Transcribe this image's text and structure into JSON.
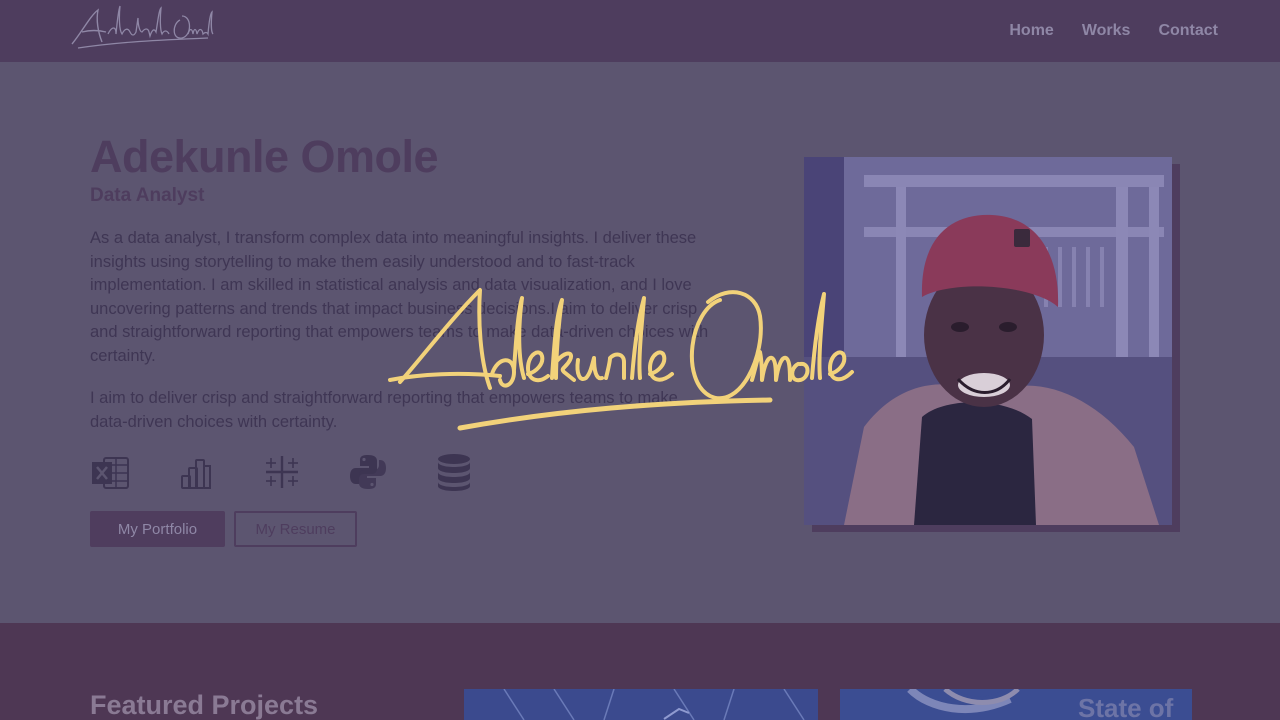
{
  "nav": {
    "logo_text": "Adekunle Omole",
    "links": [
      "Home",
      "Works",
      "Contact"
    ]
  },
  "hero": {
    "name": "Adekunle Omole",
    "role": "Data Analyst",
    "bio_paragraph_1": "As a data analyst, I transform complex data into meaningful insights. I deliver these insights using storytelling to make them easily understood and to fast-track implementation. I am skilled in statistical analysis and data visualization, and I love uncovering patterns and trends that impact business decisions.I aim to deliver crisp and straightforward reporting that empowers teams to make data-driven choices with certainty.",
    "bio_paragraph_2": "I aim to deliver crisp and straightforward reporting that empowers teams to make data-driven choices with certainty.",
    "tool_icons": [
      "excel-icon",
      "power-bi-icon",
      "tableau-icon",
      "python-icon",
      "database-icon"
    ],
    "buttons": {
      "portfolio": "My Portfolio",
      "resume": "My Resume"
    }
  },
  "projects": {
    "title": "Featured Projects",
    "thumbnail_2_text": "State of"
  },
  "loading_overlay": {
    "signature_text": "Adekunle Omole"
  },
  "colors": {
    "nav_bg": "#4e3d5e",
    "hero_bg": "#5c5570",
    "accent": "#4f3d5e",
    "signature_gold": "#f2d27a"
  }
}
